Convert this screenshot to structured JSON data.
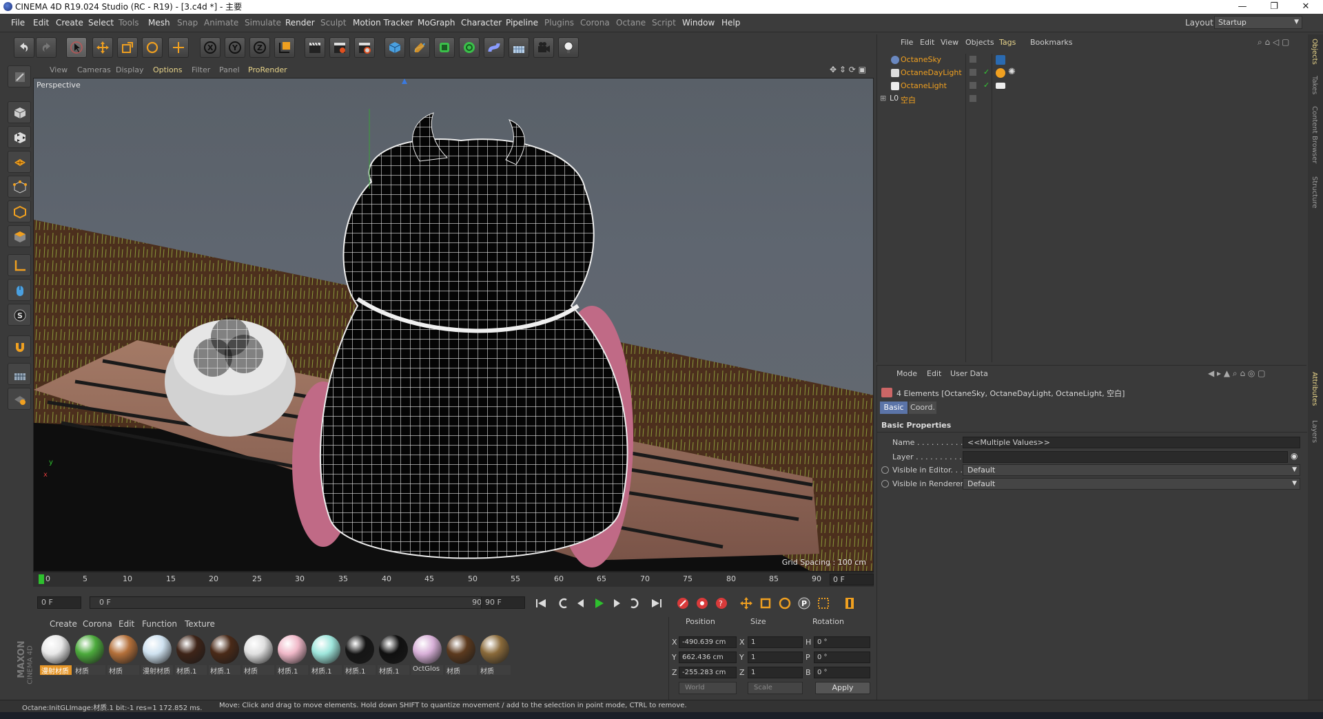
{
  "window": {
    "title": "CINEMA 4D R19.024 Studio (RC - R19) - [3.c4d *] - 主要",
    "controls": [
      "—",
      "❐",
      "✕"
    ]
  },
  "menubar": {
    "items": [
      "File",
      "Edit",
      "Create",
      "Select",
      "Tools",
      "Mesh",
      "Snap",
      "Animate",
      "Simulate",
      "Render",
      "Sculpt",
      "Motion Tracker",
      "MoGraph",
      "Character",
      "Pipeline",
      "Plugins",
      "Corona",
      "Octane",
      "Script",
      "Window",
      "Help"
    ],
    "layout_label": "Layout:",
    "layout_value": "Startup"
  },
  "viewport": {
    "menu": [
      "View",
      "Cameras",
      "Display",
      "Options",
      "Filter",
      "Panel",
      "ProRender"
    ],
    "highlighted": "Options",
    "label": "Perspective",
    "grid_spacing": "Grid Spacing : 100 cm"
  },
  "timeline": {
    "ticks": [
      "0",
      "5",
      "10",
      "15",
      "20",
      "25",
      "30",
      "35",
      "40",
      "45",
      "50",
      "55",
      "60",
      "65",
      "70",
      "75",
      "80",
      "85",
      "90"
    ],
    "current_frame": "0 F"
  },
  "transport": {
    "start": "0 F",
    "slider_start": "0 F",
    "slider_end": "90 F",
    "end": "90 F"
  },
  "materials": {
    "menu": [
      "Create",
      "Corona",
      "Edit",
      "Function",
      "Texture"
    ],
    "items": [
      {
        "label": "漫射材质",
        "color": "#e8e8e8",
        "selected": true
      },
      {
        "label": "材质",
        "color": "#4caa3c"
      },
      {
        "label": "材质",
        "color": "#b4703a"
      },
      {
        "label": "漫射材质",
        "color": "#cfe2f0"
      },
      {
        "label": "材质.1",
        "color": "#3e2418"
      },
      {
        "label": "材质.1",
        "color": "#4a2a18"
      },
      {
        "label": "材质",
        "color": "#e0e0e0"
      },
      {
        "label": "材质.1",
        "color": "#f0b8c8"
      },
      {
        "label": "材质.1",
        "color": "#9ee6dc"
      },
      {
        "label": "材质.1",
        "color": "#151515"
      },
      {
        "label": "材质.1",
        "color": "#101010"
      },
      {
        "label": "OctGlos",
        "color": "#d8b0d8"
      },
      {
        "label": "材质",
        "color": "#5c3a1e"
      },
      {
        "label": "材质",
        "color": "#8a6a3a"
      }
    ]
  },
  "coords": {
    "headers": [
      "Position",
      "Size",
      "Rotation"
    ],
    "rows": [
      {
        "axis": "X",
        "pos": "-490.639 cm",
        "size_axis": "X",
        "size": "1",
        "rot_axis": "H",
        "rot": "0 °"
      },
      {
        "axis": "Y",
        "pos": "662.436 cm",
        "size_axis": "Y",
        "size": "1",
        "rot_axis": "P",
        "rot": "0 °"
      },
      {
        "axis": "Z",
        "pos": "-255.283 cm",
        "size_axis": "Z",
        "size": "1",
        "rot_axis": "B",
        "rot": "0 °"
      }
    ],
    "mode_world": "World",
    "mode_scale": "Scale",
    "apply": "Apply"
  },
  "objects": {
    "menu": [
      "File",
      "Edit",
      "View",
      "Objects",
      "Tags",
      "Bookmarks"
    ],
    "highlighted": "Tags",
    "items": [
      {
        "name": "OctaneSky"
      },
      {
        "name": "OctaneDayLight"
      },
      {
        "name": "OctaneLight"
      },
      {
        "name": "空白"
      }
    ]
  },
  "attributes": {
    "menu": [
      "Mode",
      "Edit",
      "User Data"
    ],
    "summary": "4 Elements [OctaneSky, OctaneDayLight, OctaneLight, 空白]",
    "tabs": [
      "Basic",
      "Coord."
    ],
    "section": "Basic Properties",
    "name_label": "Name . . . . . . . . . . . .",
    "name_value": "<<Multiple Values>>",
    "layer_label": "Layer . . . . . . . . . . . .",
    "visible_editor_label": "Visible in Editor. . .",
    "visible_editor_value": "Default",
    "visible_renderer_label": "Visible in Renderer",
    "visible_renderer_value": "Default"
  },
  "side_tabs": [
    "Objects",
    "Takes",
    "Content Browser",
    "Structure"
  ],
  "side_tabs_lower": [
    "Attributes",
    "Layers"
  ],
  "brand": [
    "MAXON",
    "CINEMA 4D"
  ],
  "status": {
    "left": "Octane:InitGLImage:材质.1  bit:-1 res=1  172.852 ms.",
    "message": "Move: Click and drag to move elements. Hold down SHIFT to quantize movement / add to the selection in point mode, CTRL to remove."
  },
  "colors": {
    "accent_orange": "#f0a020",
    "tab_blue": "#5b74a8",
    "play_green": "#2ec02e",
    "record_red": "#d83a3a"
  }
}
